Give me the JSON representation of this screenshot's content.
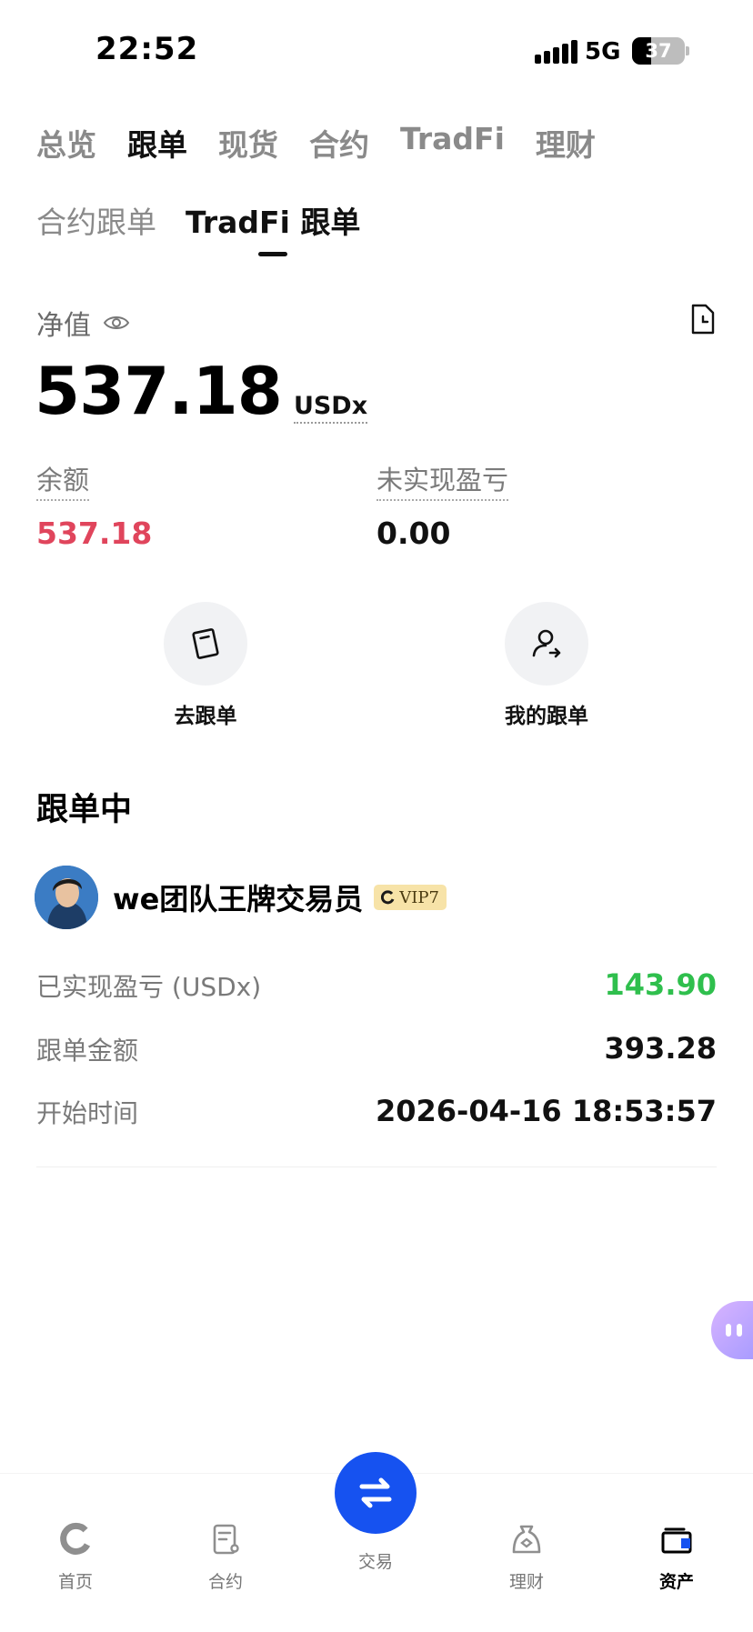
{
  "status_bar": {
    "time": "22:52",
    "network": "5G",
    "battery": "37",
    "battery_level": 0.37
  },
  "main_tabs": [
    {
      "label": "总览",
      "active": false
    },
    {
      "label": "跟单",
      "active": true
    },
    {
      "label": "现货",
      "active": false
    },
    {
      "label": "合约",
      "active": false
    },
    {
      "label": "TradFi",
      "active": false
    },
    {
      "label": "理财",
      "active": false
    }
  ],
  "sub_tabs": [
    {
      "label": "合约跟单",
      "active": false
    },
    {
      "label": "TradFi 跟单",
      "active": true
    }
  ],
  "net_value": {
    "label": "净值",
    "value": "537.18",
    "unit": "USDx"
  },
  "stats": {
    "balance_label": "余额",
    "balance_value": "537.18",
    "unrealized_label": "未实现盈亏",
    "unrealized_value": "0.00"
  },
  "actions": {
    "go_copy": "去跟单",
    "my_copy": "我的跟单"
  },
  "section": {
    "title": "跟单中"
  },
  "trader": {
    "name": "we团队王牌交易员",
    "vip": "VIP7",
    "realized_pnl_label": "已实现盈亏 (USDx)",
    "realized_pnl_value": "143.90",
    "copy_amount_label": "跟单金额",
    "copy_amount_value": "393.28",
    "start_time_label": "开始时间",
    "start_time_value": "2026-04-16 18:53:57"
  },
  "tab_bar": {
    "home": "首页",
    "futures": "合约",
    "trade": "交易",
    "earn": "理财",
    "assets": "资产"
  },
  "colors": {
    "accent_blue": "#1652f0",
    "positive_green": "#2fbf4d",
    "balance_red": "#e0455c",
    "vip_gold": "#f7e3a8"
  }
}
